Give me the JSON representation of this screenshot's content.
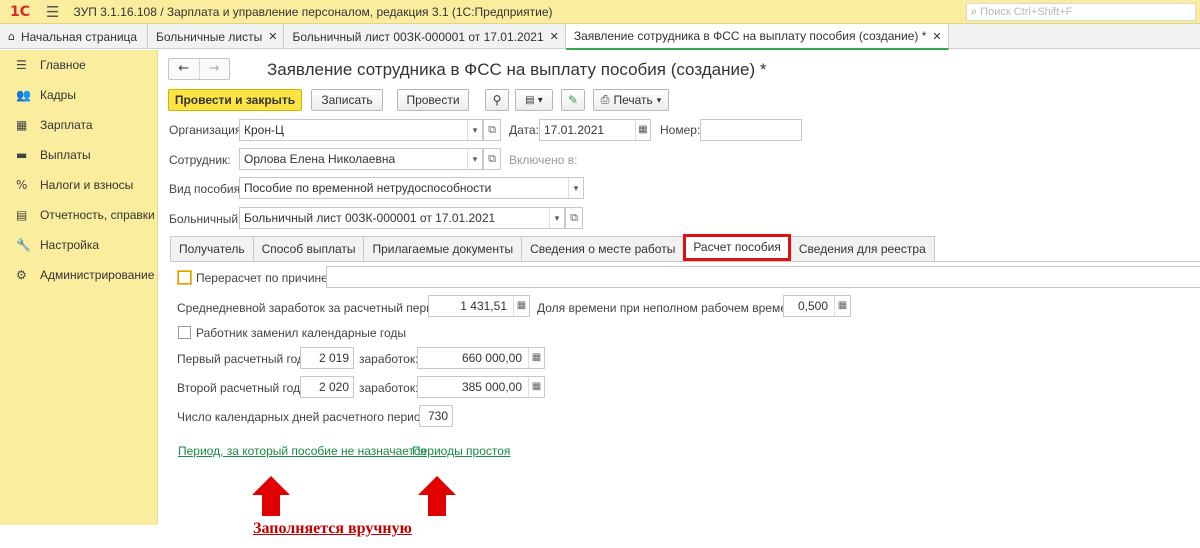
{
  "titlebar": {
    "logo": "1С",
    "title": "ЗУП 3.1.16.108 / Зарплата и управление персоналом, редакция 3.1 (1С:Предприятие)",
    "search_placeholder": "Поиск Ctrl+Shift+F"
  },
  "open_tabs": [
    {
      "label": "Начальная страница"
    },
    {
      "label": "Больничные листы"
    },
    {
      "label": "Больничный лист 00ЗК-000001 от 17.01.2021"
    },
    {
      "label": "Заявление сотрудника в ФСС на выплату пособия (создание) *"
    }
  ],
  "sidebar": {
    "items": [
      {
        "label": "Главное",
        "icon": "menu-icon"
      },
      {
        "label": "Кадры",
        "icon": "people-icon"
      },
      {
        "label": "Зарплата",
        "icon": "calculator-icon"
      },
      {
        "label": "Выплаты",
        "icon": "wallet-icon"
      },
      {
        "label": "Налоги и взносы",
        "icon": "percent-icon"
      },
      {
        "label": "Отчетность, справки",
        "icon": "report-icon"
      },
      {
        "label": "Настройка",
        "icon": "wrench-icon"
      },
      {
        "label": "Администрирование",
        "icon": "gear-icon"
      }
    ]
  },
  "doc": {
    "title": "Заявление сотрудника в ФСС на выплату пособия (создание) *"
  },
  "toolbar": {
    "post_close": "Провести и закрыть",
    "save": "Записать",
    "post": "Провести",
    "print": "Печать"
  },
  "form": {
    "org_label": "Организация:",
    "org_value": "Крон-Ц",
    "date_label": "Дата:",
    "date_value": "17.01.2021",
    "number_label": "Номер:",
    "number_value": "",
    "employee_label": "Сотрудник:",
    "employee_value": "Орлова Елена Николаевна",
    "included_label": "Включено в:",
    "benefit_label": "Вид пособия:",
    "benefit_value": "Пособие по временной нетрудоспособности",
    "sick_label": "Больничный:",
    "sick_value": "Больничный лист 00ЗК-000001 от 17.01.2021"
  },
  "inner_tabs": [
    {
      "label": "Получатель"
    },
    {
      "label": "Способ выплаты"
    },
    {
      "label": "Прилагаемые документы"
    },
    {
      "label": "Сведения о месте работы"
    },
    {
      "label": "Расчет пособия"
    },
    {
      "label": "Сведения для реестра"
    }
  ],
  "calc": {
    "recalc_label": "Перерасчет по причине:",
    "recalc_value": "",
    "avg_label": "Среднедневной заработок за расчетный период:",
    "avg_value": "1 431,51",
    "share_label": "Доля времени при неполном рабочем времени:",
    "share_value": "0,500",
    "replaced_label": "Работник заменил календарные годы",
    "year1_label": "Первый расчетный год:",
    "year1_value": "2 019",
    "earn_label": "заработок:",
    "earn1_value": "660 000,00",
    "year2_label": "Второй расчетный год:",
    "year2_value": "2 020",
    "earn2_value": "385 000,00",
    "days_label": "Число календарных дней расчетного периода:",
    "days_value": "730",
    "link1": "Период, за который пособие не назначается",
    "link2": "Периоды простоя"
  },
  "annotation": {
    "text": "Заполняется вручную",
    "arrow_color": "#e00000",
    "highlight_color": "#e01010"
  }
}
